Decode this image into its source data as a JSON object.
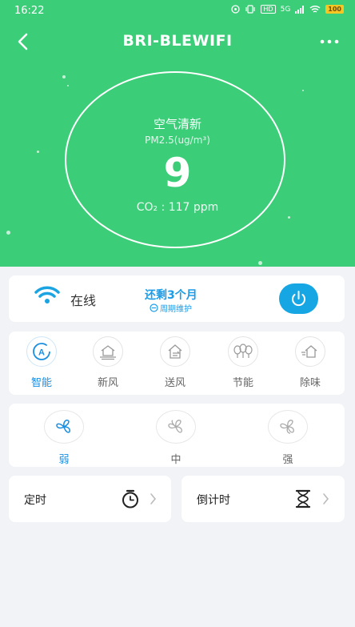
{
  "status_bar": {
    "time": "16:22",
    "network": "5G",
    "hd": "HD",
    "battery": "100"
  },
  "header": {
    "title": "BRI-BLEWIFI"
  },
  "air": {
    "quality": "空气清新",
    "pm_label": "PM2.5(ug/m³)",
    "pm_value": "9",
    "co2": "CO₂ : 117 ppm"
  },
  "device": {
    "status": "在线",
    "remaining": "还剩3个月",
    "maintenance": "周期维护"
  },
  "modes": [
    {
      "label": "智能",
      "icon": "smart-mode-icon",
      "active": true
    },
    {
      "label": "新风",
      "icon": "fresh-air-icon",
      "active": false
    },
    {
      "label": "送风",
      "icon": "supply-air-icon",
      "active": false
    },
    {
      "label": "节能",
      "icon": "energy-save-icon",
      "active": false
    },
    {
      "label": "除味",
      "icon": "deodorize-icon",
      "active": false
    }
  ],
  "speeds": [
    {
      "label": "弱",
      "active": true
    },
    {
      "label": "中",
      "active": false
    },
    {
      "label": "强",
      "active": false
    }
  ],
  "timer": {
    "label": "定时"
  },
  "countdown": {
    "label": "倒计时"
  },
  "colors": {
    "hero": "#3ccd79",
    "accent": "#1a8fe0",
    "power": "#16a6e4"
  }
}
